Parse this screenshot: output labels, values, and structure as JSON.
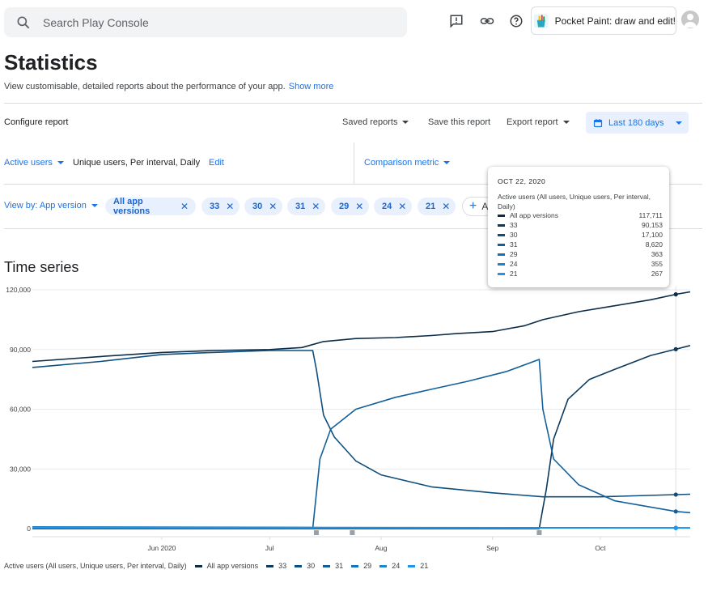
{
  "search": {
    "placeholder": "Search Play Console"
  },
  "header": {
    "app_name": "Pocket Paint: draw and edit!"
  },
  "page": {
    "title": "Statistics",
    "subtitle": "View customisable, detailed reports about the performance of your app.",
    "show_more": "Show more"
  },
  "toolbar": {
    "configure_report": "Configure report",
    "saved_reports": "Saved reports",
    "save_this_report": "Save this report",
    "export_report": "Export report",
    "date_range": "Last 180 days"
  },
  "metric": {
    "label": "Active users",
    "detail": "Unique users, Per interval, Daily",
    "edit": "Edit",
    "comparison": "Comparison metric"
  },
  "view_by": {
    "label": "View by: App version",
    "chips": [
      {
        "label": "All app versions"
      },
      {
        "label": "33"
      },
      {
        "label": "30"
      },
      {
        "label": "31"
      },
      {
        "label": "29"
      },
      {
        "label": "24"
      },
      {
        "label": "21"
      }
    ],
    "add_label": "A"
  },
  "section": {
    "title": "Time series"
  },
  "tooltip": {
    "date": "OCT 22, 2020",
    "metric": "Active users (All users, Unique users, Per interval, Daily)",
    "rows": [
      {
        "name": "All app versions",
        "value": "117,711",
        "color": "#0b2d4a"
      },
      {
        "name": "33",
        "value": "90,153",
        "color": "#0c3a5e"
      },
      {
        "name": "30",
        "value": "17,100",
        "color": "#0f4f7d"
      },
      {
        "name": "31",
        "value": "8,620",
        "color": "#12609b"
      },
      {
        "name": "29",
        "value": "363",
        "color": "#1673b8"
      },
      {
        "name": "24",
        "value": "355",
        "color": "#1a85d0"
      },
      {
        "name": "21",
        "value": "267",
        "color": "#2196e8"
      }
    ]
  },
  "legend": {
    "metric": "Active users (All users, Unique users, Per interval, Daily)",
    "items": [
      {
        "name": "All app versions",
        "color": "#0b2d4a"
      },
      {
        "name": "33",
        "color": "#0c3a5e"
      },
      {
        "name": "30",
        "color": "#0f4f7d"
      },
      {
        "name": "31",
        "color": "#12609b"
      },
      {
        "name": "29",
        "color": "#1673b8"
      },
      {
        "name": "24",
        "color": "#1a85d0"
      },
      {
        "name": "21",
        "color": "#2196e8"
      }
    ]
  },
  "chart_data": {
    "type": "line",
    "y_ticks": [
      "0",
      "30,000",
      "60,000",
      "90,000",
      "120,000"
    ],
    "x_ticks": [
      "Jun 2020",
      "Jul",
      "Aug",
      "Sep",
      "Oct"
    ],
    "ylim": [
      0,
      120000
    ],
    "series": [
      {
        "name": "All app versions",
        "color": "#0b2d4a",
        "points": [
          [
            "2020-04-26",
            84000
          ],
          [
            "2020-05-15",
            86500
          ],
          [
            "2020-06-01",
            88500
          ],
          [
            "2020-06-15",
            89500
          ],
          [
            "2020-07-01",
            90000
          ],
          [
            "2020-07-10",
            91000
          ],
          [
            "2020-07-16",
            94000
          ],
          [
            "2020-07-25",
            95500
          ],
          [
            "2020-08-05",
            96000
          ],
          [
            "2020-08-15",
            97000
          ],
          [
            "2020-08-22",
            98000
          ],
          [
            "2020-09-01",
            99000
          ],
          [
            "2020-09-10",
            102000
          ],
          [
            "2020-09-15",
            105000
          ],
          [
            "2020-09-25",
            109000
          ],
          [
            "2020-10-05",
            112000
          ],
          [
            "2020-10-15",
            115000
          ],
          [
            "2020-10-22",
            117711
          ],
          [
            "2020-10-26",
            119000
          ]
        ]
      },
      {
        "name": "33",
        "color": "#0c3a5e",
        "points": [
          [
            "2020-04-26",
            0
          ],
          [
            "2020-09-14",
            0
          ],
          [
            "2020-09-16",
            20000
          ],
          [
            "2020-09-18",
            45000
          ],
          [
            "2020-09-22",
            65000
          ],
          [
            "2020-09-28",
            75000
          ],
          [
            "2020-10-05",
            80000
          ],
          [
            "2020-10-15",
            87000
          ],
          [
            "2020-10-22",
            90153
          ],
          [
            "2020-10-26",
            92000
          ]
        ]
      },
      {
        "name": "30",
        "color": "#0f4f7d",
        "points": [
          [
            "2020-04-26",
            81000
          ],
          [
            "2020-05-15",
            84000
          ],
          [
            "2020-06-01",
            87500
          ],
          [
            "2020-06-15",
            88500
          ],
          [
            "2020-07-01",
            89500
          ],
          [
            "2020-07-13",
            89500
          ],
          [
            "2020-07-14",
            80000
          ],
          [
            "2020-07-16",
            57000
          ],
          [
            "2020-07-19",
            46000
          ],
          [
            "2020-07-25",
            34000
          ],
          [
            "2020-08-01",
            27000
          ],
          [
            "2020-08-15",
            21000
          ],
          [
            "2020-09-01",
            18000
          ],
          [
            "2020-09-15",
            16000
          ],
          [
            "2020-10-01",
            16000
          ],
          [
            "2020-10-22",
            17100
          ],
          [
            "2020-10-26",
            17300
          ]
        ]
      },
      {
        "name": "31",
        "color": "#12609b",
        "points": [
          [
            "2020-04-26",
            0
          ],
          [
            "2020-07-13",
            0
          ],
          [
            "2020-07-15",
            35000
          ],
          [
            "2020-07-18",
            50000
          ],
          [
            "2020-07-25",
            60000
          ],
          [
            "2020-08-05",
            66000
          ],
          [
            "2020-08-15",
            70000
          ],
          [
            "2020-08-25",
            74000
          ],
          [
            "2020-09-05",
            79000
          ],
          [
            "2020-09-14",
            85000
          ],
          [
            "2020-09-15",
            60000
          ],
          [
            "2020-09-18",
            35000
          ],
          [
            "2020-09-25",
            22000
          ],
          [
            "2020-10-05",
            14000
          ],
          [
            "2020-10-22",
            8620
          ],
          [
            "2020-10-26",
            8000
          ]
        ]
      },
      {
        "name": "29",
        "color": "#1673b8",
        "points": [
          [
            "2020-04-26",
            900
          ],
          [
            "2020-07-15",
            600
          ],
          [
            "2020-10-26",
            363
          ]
        ]
      },
      {
        "name": "24",
        "color": "#1a85d0",
        "points": [
          [
            "2020-04-26",
            700
          ],
          [
            "2020-07-15",
            500
          ],
          [
            "2020-10-26",
            355
          ]
        ]
      },
      {
        "name": "21",
        "color": "#2196e8",
        "points": [
          [
            "2020-04-26",
            500
          ],
          [
            "2020-07-15",
            400
          ],
          [
            "2020-10-26",
            267
          ]
        ]
      }
    ],
    "highlight_date": "2020-10-22",
    "annotation_dates": [
      "2020-07-14",
      "2020-07-24",
      "2020-09-14"
    ],
    "grid": true
  }
}
